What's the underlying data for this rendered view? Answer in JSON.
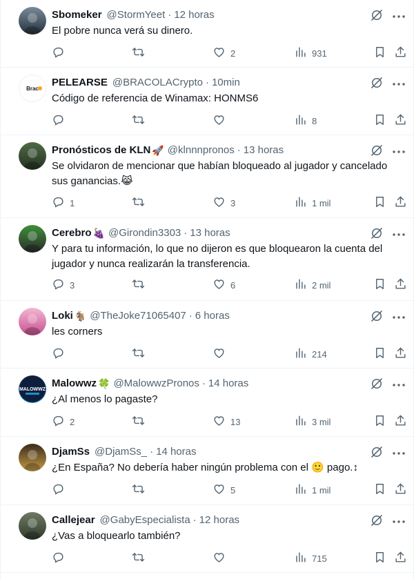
{
  "tweets": [
    {
      "name": "Sbomeker",
      "name_emoji": "",
      "handle": "@StormYeet",
      "time": "12 horas",
      "text": "El pobre nunca verá su dinero.",
      "replies": "",
      "retweets": "",
      "likes": "2",
      "views": "931",
      "avatar_colors": [
        "#7a8a9a",
        "#23303c"
      ]
    },
    {
      "name": "PELEARSE",
      "name_emoji": "",
      "handle": "@BRACOLACrypto",
      "time": "10min",
      "text": "Código de referencia de Winamax: HONMS6",
      "replies": "",
      "retweets": "",
      "likes": "",
      "views": "8",
      "avatar_colors": [
        "#ffffff",
        "#d9d9d9"
      ],
      "avatar_label": "BracOla"
    },
    {
      "name": "Pronósticos de KLN",
      "name_emoji": "🚀",
      "handle": "@klnnnpronos",
      "time": "13 horas",
      "text": "Se olvidaron de mencionar que habían bloqueado al jugador y cancelado sus ganancias.😹",
      "replies": "1",
      "retweets": "",
      "likes": "3",
      "views": "1 mil",
      "avatar_colors": [
        "#4f6a46",
        "#243322"
      ]
    },
    {
      "name": "Cerebro",
      "name_emoji": "🍇",
      "handle": "@Girondin3303",
      "time": "13 horas",
      "text": "Y para tu información, lo que no dijeron es que bloquearon la cuenta del jugador y nunca realizarán la transferencia.",
      "replies": "3",
      "retweets": "",
      "likes": "6",
      "views": "2 mil",
      "avatar_colors": [
        "#3f8f3a",
        "#2b2b2b"
      ]
    },
    {
      "name": "Loki",
      "name_emoji": "🐐",
      "handle": "@TheJoke71065407",
      "time": "6 horas",
      "text": "les corners",
      "replies": "",
      "retweets": "",
      "likes": "",
      "views": "214",
      "avatar_colors": [
        "#f3b6d3",
        "#c64f8f"
      ]
    },
    {
      "name": "Malowwz",
      "name_emoji": "🍀",
      "handle": "@MalowwzPronos",
      "time": "14 horas",
      "text": "¿Al menos lo pagaste?",
      "replies": "2",
      "retweets": "",
      "likes": "13",
      "views": "3 mil",
      "avatar_colors": [
        "#0e1f3d",
        "#1e90c8"
      ],
      "avatar_label": "MALOWWZ"
    },
    {
      "name": "DjamSs",
      "name_emoji": "",
      "handle": "@DjamSs_",
      "time": "14 horas",
      "text": "¿En España? No debería haber ningún problema con el 🙂 pago.↕",
      "replies": "",
      "retweets": "",
      "likes": "5",
      "views": "1 mil",
      "avatar_colors": [
        "#3a2c1a",
        "#c49a49"
      ]
    },
    {
      "name": "Callejear",
      "name_emoji": "",
      "handle": "@GabyEspecialista",
      "time": "12 horas",
      "text": "¿Vas a bloquearlo también?",
      "replies": "",
      "retweets": "",
      "likes": "",
      "views": "715",
      "avatar_colors": [
        "#6f7a63",
        "#2f3a2c"
      ]
    }
  ]
}
